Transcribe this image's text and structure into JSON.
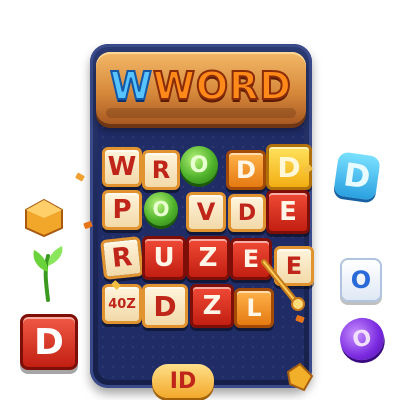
{
  "title": {
    "first_letter": "W",
    "rest": "WORD"
  },
  "grid": {
    "row1": [
      "W",
      "R",
      "O",
      "D",
      "D"
    ],
    "row2": [
      "P",
      "O",
      "V",
      "D",
      "E"
    ],
    "row3": [
      "R",
      "U",
      "Z",
      "E",
      "E"
    ],
    "row4": [
      "40Z",
      "D",
      "Z",
      "L"
    ]
  },
  "floating": {
    "left_d": "D",
    "right_top_d": "D",
    "right_mid_o": "O",
    "right_bottom_o": "O",
    "bottom_id": "ID"
  },
  "colors": {
    "board": "#1f2c66",
    "plank": "#d88a3c",
    "title_blue": "#58c4ff",
    "title_orange": "#ff8a1a",
    "tile_red": "#c21f12",
    "tile_cream": "#f2d9a8",
    "ring_green": "#4fb22a"
  }
}
